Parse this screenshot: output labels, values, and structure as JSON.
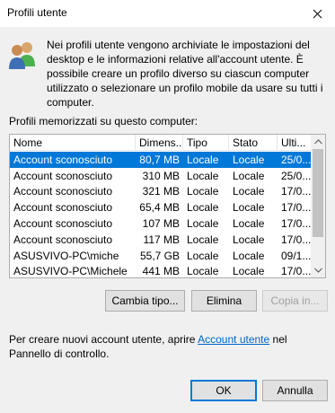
{
  "window": {
    "title": "Profili utente"
  },
  "info": {
    "text": "Nei profili utente vengono archiviate le impostazioni del desktop e le informazioni relative all'account utente. È possibile creare un profilo diverso su ciascun computer utilizzato o selezionare un profilo mobile da usare su tutti i computer."
  },
  "profiles": {
    "label": "Profili memorizzati su questo computer:",
    "columns": [
      "Nome",
      "Dimens...",
      "Tipo",
      "Stato",
      "Ulti..."
    ],
    "rows": [
      [
        "Account sconosciuto",
        "80,7 MB",
        "Locale",
        "Locale",
        "25/0..."
      ],
      [
        "Account sconosciuto",
        "310 MB",
        "Locale",
        "Locale",
        "25/0..."
      ],
      [
        "Account sconosciuto",
        "321 MB",
        "Locale",
        "Locale",
        "17/0..."
      ],
      [
        "Account sconosciuto",
        "65,4 MB",
        "Locale",
        "Locale",
        "17/0..."
      ],
      [
        "Account sconosciuto",
        "107 MB",
        "Locale",
        "Locale",
        "17/0..."
      ],
      [
        "Account sconosciuto",
        "117 MB",
        "Locale",
        "Locale",
        "17/0..."
      ],
      [
        "ASUSVIVO-PC\\miche",
        "55,7 GB",
        "Locale",
        "Locale",
        "09/1..."
      ],
      [
        "ASUSVIVO-PC\\Michele",
        "441 MB",
        "Locale",
        "Locale",
        "17/0..."
      ]
    ],
    "selected_row": 0
  },
  "buttons": {
    "change_type": "Cambia tipo...",
    "delete": "Elimina",
    "copy_to": "Copia in...",
    "ok": "OK",
    "cancel": "Annulla"
  },
  "footer": {
    "before": "Per creare nuovi account utente, aprire ",
    "link": "Account utente",
    "after": " nel Pannello di controllo."
  },
  "colors": {
    "selection": "#0078d7",
    "link": "#0066cc"
  }
}
